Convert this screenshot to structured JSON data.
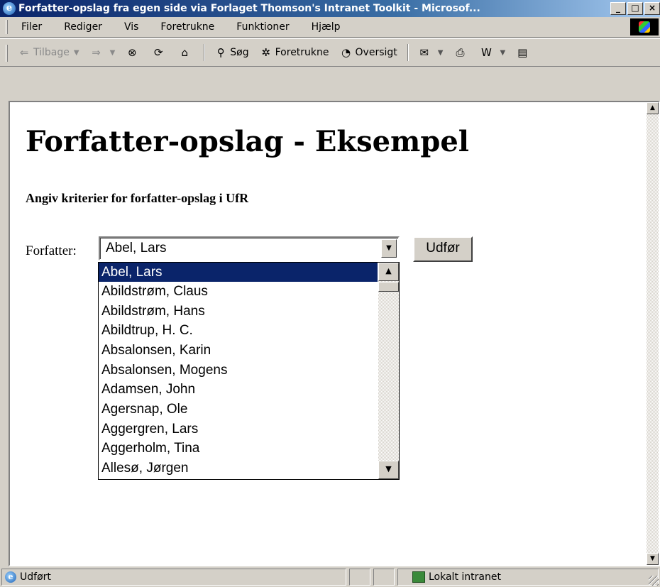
{
  "window": {
    "title": "Forfatter-opslag fra egen side via Forlaget Thomson's Intranet Toolkit - Microsof...",
    "minimize": "_",
    "maximize": "□",
    "close": "×"
  },
  "menu": {
    "items": [
      "Filer",
      "Rediger",
      "Vis",
      "Foretrukne",
      "Funktioner",
      "Hjælp"
    ]
  },
  "toolbar": {
    "back": "Tilbage",
    "search": "Søg",
    "favorites": "Foretrukne",
    "history": "Oversigt"
  },
  "page": {
    "heading": "Forfatter-opslag - Eksempel",
    "subheading": "Angiv kriterier for forfatter-opslag i UfR",
    "author_label": "Forfatter:",
    "selected_author": "Abel, Lars",
    "submit_label": "Udfør",
    "options": [
      "Abel, Lars",
      "Abildstrøm, Claus",
      "Abildstrøm, Hans",
      "Abildtrup, H. C.",
      "Absalonsen, Karin",
      "Absalonsen, Mogens",
      "Adamsen, John",
      "Agersnap, Ole",
      "Aggergren, Lars",
      "Aggerholm, Tina",
      "Allesø, Jørgen"
    ]
  },
  "status": {
    "text": "Udført",
    "zone": "Lokalt intranet"
  },
  "colors": {
    "title_bar": "#0a246a",
    "selection": "#0a246a",
    "chrome": "#d4d0c8"
  },
  "icons": {
    "app": "ie-logo-icon",
    "back": "arrow-left-icon",
    "forward": "arrow-right-icon",
    "stop": "stop-icon",
    "refresh": "refresh-icon",
    "home": "home-icon",
    "search": "search-icon",
    "favorites": "favorites-icon",
    "history": "history-icon",
    "mail": "mail-icon",
    "print": "printer-icon",
    "edit": "word-icon",
    "discuss": "discuss-icon"
  }
}
